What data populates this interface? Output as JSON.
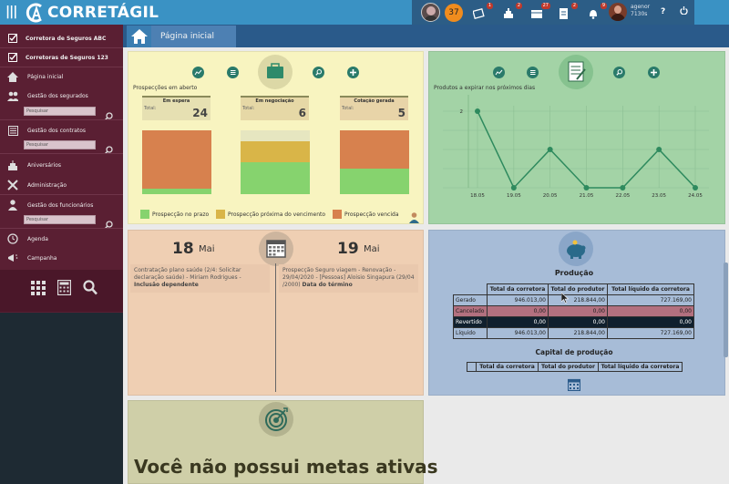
{
  "app": {
    "name": "CORRETÁGIL"
  },
  "topbar": {
    "notifications_count": "37",
    "badges": [
      "1",
      "2",
      "27",
      "2",
      "9"
    ],
    "user_name": "agenor",
    "user_time": "7130s",
    "help": "?"
  },
  "sidebar": {
    "items": [
      {
        "label": "Corretora de Seguros ABC"
      },
      {
        "label": "Corretoras de Seguros 123"
      },
      {
        "label": "Página inicial"
      },
      {
        "label": "Gestão dos segurados"
      },
      {
        "label": "Gestão dos contratos"
      },
      {
        "label": "Aniversários"
      },
      {
        "label": "Administração"
      },
      {
        "label": "Gestão dos funcionários"
      },
      {
        "label": "Agenda"
      },
      {
        "label": "Campanha"
      }
    ],
    "search_placeholder": "Pesquisar"
  },
  "breadcrumb": {
    "current": "Página inicial"
  },
  "prospects": {
    "title": "Prospecções em aberto",
    "total_label": "Total:",
    "boxes": [
      {
        "title": "Em espera",
        "total": "24"
      },
      {
        "title": "Em negociação",
        "total": "6"
      },
      {
        "title": "Cotação gerada",
        "total": "5"
      }
    ],
    "bars": [
      {
        "on_time": 2,
        "near_due": 0,
        "overdue": 22
      },
      {
        "on_time": 3,
        "near_due": 2,
        "overdue": 0
      },
      {
        "on_time": 2,
        "near_due": 0,
        "overdue": 3
      }
    ],
    "legend": [
      "Prospecção no prazo",
      "Prospecção próxima do vencimento",
      "Prospecção vencida"
    ],
    "colors": {
      "on_time": "#86d36e",
      "near_due": "#d9b548",
      "overdue": "#d7814e",
      "empty": "#e6e6c0"
    }
  },
  "expiring": {
    "title": "Produtos a expirar nos próximos dias",
    "chart_data": {
      "type": "line",
      "x": [
        "18.05",
        "19.05",
        "20.05",
        "21.05",
        "22.05",
        "23.05",
        "24.05"
      ],
      "y": [
        2,
        0,
        1,
        0,
        0,
        1,
        0
      ],
      "ylim": [
        0,
        2
      ],
      "ytick_labels": [
        "2"
      ],
      "color": "#2e8a5e"
    }
  },
  "agenda": {
    "days": [
      {
        "day": "18",
        "month": "Mai",
        "text": "Contratação plano saúde (2/4: Solicitar declaração saúde) - Miriam Rodrigues - ",
        "bold": "Inclusão dependente"
      },
      {
        "day": "19",
        "month": "Mai",
        "text": "Prospecção Seguro viagem - Renovação - 29/04/2020 - [Pessoas] Aloisio Singapura (29/04 /2000) ",
        "bold": "Data do término"
      }
    ]
  },
  "production": {
    "title": "Produção",
    "columns": [
      "Total da corretora",
      "Total do produtor",
      "Total líquido da corretora"
    ],
    "rows": [
      {
        "label": "Gerado",
        "values": [
          "946.013,00",
          "218.844,00",
          "727.169,00"
        ]
      },
      {
        "label": "Cancelado",
        "values": [
          "0,00",
          "0,00",
          "0,00"
        ]
      },
      {
        "label": "Revertido",
        "values": [
          "0,00",
          "0,00",
          "0,00"
        ]
      },
      {
        "label": "Líquido",
        "values": [
          "946.013,00",
          "218.844,00",
          "727.169,00"
        ]
      }
    ],
    "capital_title": "Capital de produção",
    "capital_columns": [
      "Total da corretora",
      "Total do produtor",
      "Total líquido da corretora"
    ]
  },
  "goals": {
    "message": "Você não possui metas ativas"
  }
}
